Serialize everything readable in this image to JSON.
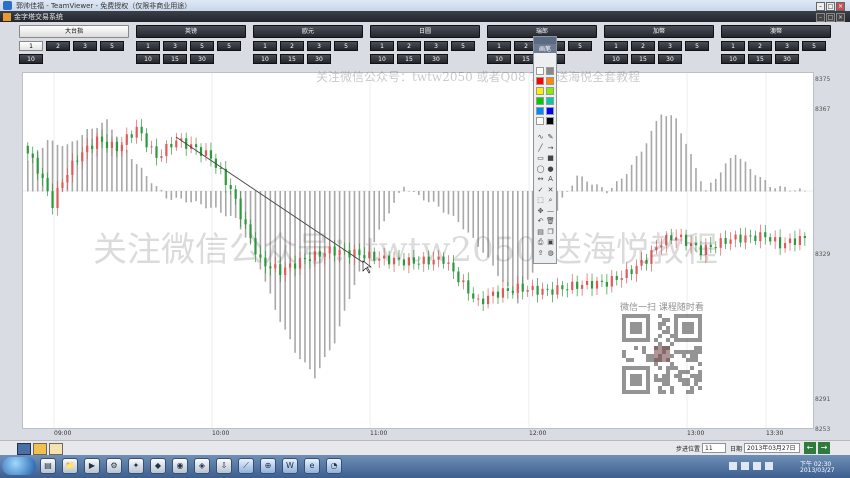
{
  "teamviewer_bar": {
    "title": "郭帅佳福 - TeamViewer - 免费授权（仅限非商业用途）"
  },
  "app_bar": {
    "title": "金字塔交易系统"
  },
  "toolbar": {
    "groups": [
      {
        "title": "大台指",
        "selected": true,
        "periods": [
          "1",
          "2",
          "3",
          "5",
          "10"
        ],
        "selected_period": "1"
      },
      {
        "title": "英镑",
        "selected": false,
        "periods": [
          "1",
          "3",
          "5",
          "5",
          "10",
          "15",
          "30"
        ]
      },
      {
        "title": "欧元",
        "selected": false,
        "periods": [
          "1",
          "2",
          "3",
          "5",
          "10",
          "15",
          "30"
        ]
      },
      {
        "title": "日圆",
        "selected": false,
        "periods": [
          "1",
          "2",
          "3",
          "5",
          "10",
          "15",
          "30"
        ]
      },
      {
        "title": "瑞郎",
        "selected": false,
        "periods": [
          "1",
          "2",
          "3",
          "5",
          "10",
          "15",
          "30"
        ]
      },
      {
        "title": "加幣",
        "selected": false,
        "periods": [
          "1",
          "2",
          "3",
          "5",
          "10",
          "15",
          "30"
        ]
      },
      {
        "title": "澳幣",
        "selected": false,
        "periods": [
          "1",
          "2",
          "3",
          "5",
          "10",
          "15",
          "30"
        ]
      }
    ]
  },
  "watermarks": {
    "top": "关注微信公众号：twtw2050 或者Q08   797 送海悦全套教程",
    "middle": "关注微信公众号：twtw2050 送海悦教程",
    "qr_caption": "微信一扫 课程随时看"
  },
  "drawing_palette": {
    "header": "画笔"
  },
  "colors": {
    "up": "#e05a5a",
    "down": "#2a9a3a",
    "histogram": "#a8a8a8",
    "trendline": "#444444",
    "chart_bg": "#ffffff"
  },
  "chart_data": {
    "type": "candlestick",
    "y_ticks": [
      "8375",
      "8367",
      "8329",
      "8291",
      "8253"
    ],
    "x_ticks": [
      "09:00",
      "10:00",
      "11:00",
      "12:00",
      "13:00",
      "13:30"
    ],
    "ylim": [
      8253,
      8375
    ],
    "price_path": [
      [
        0,
        8350
      ],
      [
        3,
        8342
      ],
      [
        6,
        8330
      ],
      [
        8,
        8338
      ],
      [
        11,
        8346
      ],
      [
        15,
        8352
      ],
      [
        19,
        8349
      ],
      [
        23,
        8356
      ],
      [
        27,
        8346
      ],
      [
        31,
        8352
      ],
      [
        35,
        8349
      ],
      [
        38,
        8346
      ],
      [
        42,
        8335
      ],
      [
        45,
        8322
      ],
      [
        48,
        8310
      ],
      [
        52,
        8307
      ],
      [
        57,
        8311
      ],
      [
        62,
        8314
      ],
      [
        67,
        8313
      ],
      [
        73,
        8311
      ],
      [
        79,
        8310
      ],
      [
        85,
        8311
      ],
      [
        90,
        8300
      ],
      [
        92,
        8296
      ],
      [
        95,
        8299
      ],
      [
        100,
        8301
      ],
      [
        106,
        8300
      ],
      [
        112,
        8302
      ],
      [
        118,
        8303
      ],
      [
        122,
        8306
      ],
      [
        126,
        8311
      ],
      [
        129,
        8317
      ],
      [
        132,
        8319
      ],
      [
        137,
        8314
      ],
      [
        143,
        8318
      ],
      [
        150,
        8319
      ],
      [
        153,
        8316
      ],
      [
        157,
        8318
      ]
    ],
    "histogram_path": [
      [
        0,
        30
      ],
      [
        4,
        50
      ],
      [
        8,
        45
      ],
      [
        12,
        60
      ],
      [
        16,
        70
      ],
      [
        20,
        40
      ],
      [
        24,
        15
      ],
      [
        28,
        -6
      ],
      [
        33,
        -10
      ],
      [
        38,
        -18
      ],
      [
        42,
        -28
      ],
      [
        46,
        -62
      ],
      [
        50,
        -118
      ],
      [
        54,
        -160
      ],
      [
        58,
        -185
      ],
      [
        62,
        -150
      ],
      [
        66,
        -92
      ],
      [
        70,
        -50
      ],
      [
        73,
        -20
      ],
      [
        76,
        5
      ],
      [
        79,
        -5
      ],
      [
        82,
        -12
      ],
      [
        87,
        -30
      ],
      [
        92,
        -60
      ],
      [
        96,
        -90
      ],
      [
        99,
        -110
      ],
      [
        102,
        -80
      ],
      [
        105,
        -40
      ],
      [
        108,
        -8
      ],
      [
        111,
        15
      ],
      [
        114,
        8
      ],
      [
        117,
        0
      ],
      [
        120,
        12
      ],
      [
        124,
        40
      ],
      [
        128,
        78
      ],
      [
        131,
        72
      ],
      [
        134,
        35
      ],
      [
        137,
        0
      ],
      [
        140,
        20
      ],
      [
        143,
        38
      ],
      [
        146,
        22
      ],
      [
        150,
        5
      ],
      [
        157,
        0
      ]
    ],
    "trendline": {
      "from": [
        "09:55",
        8362
      ],
      "to": [
        "10:57",
        8330
      ]
    }
  },
  "bottom_bar": {
    "step_label": "步进位置",
    "step_value": "11",
    "date_label": "日期",
    "date_value": "2013年03月27日"
  },
  "taskbar": {
    "start_label": "",
    "clock_time": "下午 02:30",
    "clock_date": "2013/03/27"
  }
}
